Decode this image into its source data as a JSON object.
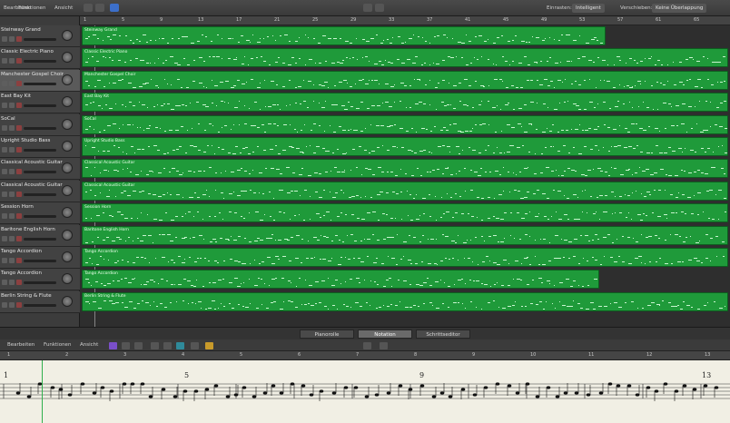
{
  "toolbar": {
    "menus": [
      "Bearbeiten",
      "Funktionen",
      "Ansicht"
    ],
    "right_labels": [
      "Einrasten:",
      "Verschieben:"
    ],
    "snap_value": "Intelligent",
    "move_value": "Keine Überlappung"
  },
  "ruler": {
    "ticks": [
      "1",
      "5",
      "9",
      "13",
      "17",
      "21",
      "25",
      "29",
      "33",
      "37",
      "41",
      "45",
      "49",
      "53",
      "57",
      "61",
      "65"
    ]
  },
  "tracks": [
    {
      "name": "Steinway Grand",
      "region": "Steinway Grand",
      "region_end": 0.81
    },
    {
      "name": "Classic Electric Piano",
      "region": "Classic Electric Piano",
      "region_end": 1.0
    },
    {
      "name": "Manchester Gospel Choir",
      "region": "Manchester Gospel Choir",
      "region_end": 1.0
    },
    {
      "name": "East Bay Kit",
      "region": "East Bay Kit",
      "region_end": 1.0
    },
    {
      "name": "SoCal",
      "region": "SoCal",
      "region_end": 1.0
    },
    {
      "name": "Upright Studio Bass",
      "region": "Upright Studio Bass",
      "region_end": 1.0
    },
    {
      "name": "Classical Acoustic Guitar",
      "region": "Classical Acoustic Guitar",
      "region_end": 1.0
    },
    {
      "name": "Classical Acoustic Guitar",
      "region": "Classical Acoustic Guitar",
      "region_end": 1.0
    },
    {
      "name": "Session Horn",
      "region": "Session Horn",
      "region_end": 1.0
    },
    {
      "name": "Baritone English Horn",
      "region": "Baritone English Horn",
      "region_end": 1.0
    },
    {
      "name": "Tango Accordion",
      "region": "Tango Accordion",
      "region_end": 1.0
    },
    {
      "name": "Tango Accordion",
      "region": "Tango Accordion",
      "region_end": 0.8
    },
    {
      "name": "Berlin String & Flute",
      "region": "Berlin String & Flute",
      "region_end": 1.0
    }
  ],
  "editor": {
    "tabs": [
      "Pianorolle",
      "Notation",
      "Schrittseditor"
    ],
    "active_tab": "Notation",
    "menus": [
      "Bearbeiten",
      "Funktionen",
      "Ansicht"
    ],
    "ruler_ticks": [
      "1",
      "2",
      "3",
      "4",
      "5",
      "6",
      "7",
      "8",
      "9",
      "10",
      "11",
      "12",
      "13"
    ],
    "measure_numbers": [
      "1",
      "5",
      "9",
      "13"
    ]
  },
  "colors": {
    "region": "#1f9a3a",
    "region_border": "#0d5e1f",
    "score_bg": "#f1efe4",
    "accent": "#3c6fc9"
  }
}
